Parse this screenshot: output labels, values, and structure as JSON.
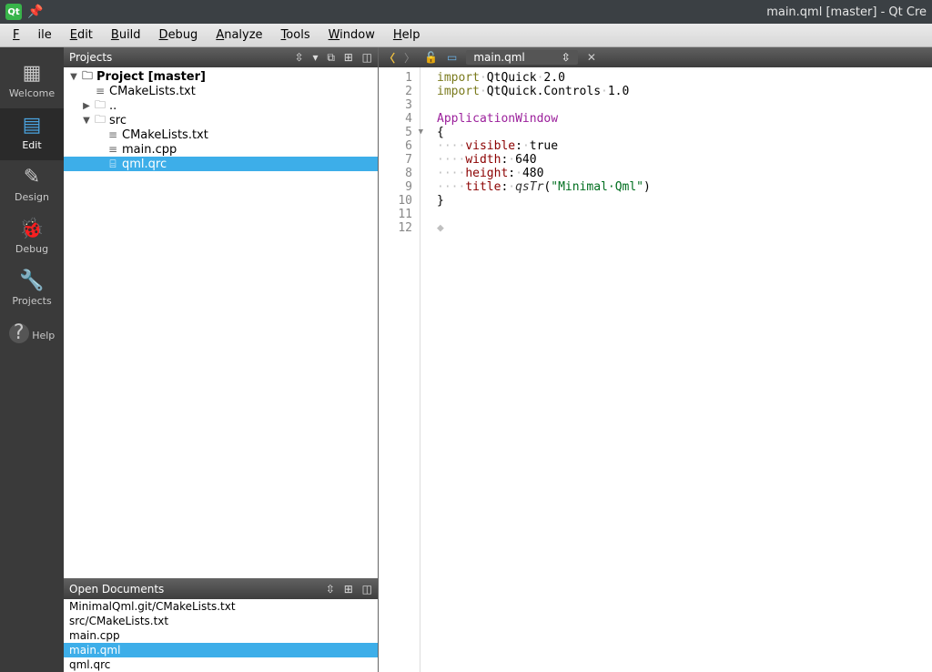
{
  "window": {
    "title": "main.qml [master] - Qt Cre"
  },
  "menu": {
    "file": "File",
    "edit": "Edit",
    "build": "Build",
    "debug": "Debug",
    "analyze": "Analyze",
    "tools": "Tools",
    "window": "Window",
    "help": "Help"
  },
  "modes": {
    "welcome": "Welcome",
    "edit": "Edit",
    "design": "Design",
    "debug": "Debug",
    "projects": "Projects",
    "help": "Help"
  },
  "projectsPanel": {
    "title": "Projects",
    "tree": {
      "root": "Project [master]",
      "cmake": "CMakeLists.txt",
      "dotdot": "..",
      "src": "src",
      "srcCmake": "CMakeLists.txt",
      "mainCpp": "main.cpp",
      "qmlQrc": "qml.qrc"
    }
  },
  "openDocsPanel": {
    "title": "Open Documents",
    "items": [
      "MinimalQml.git/CMakeLists.txt",
      "src/CMakeLists.txt",
      "main.cpp",
      "main.qml",
      "qml.qrc"
    ],
    "selectedIndex": 3
  },
  "editor": {
    "file": "main.qml",
    "lines": [
      {
        "n": "1",
        "tokens": [
          {
            "c": "kw",
            "t": "import"
          },
          {
            "c": "dots",
            "t": "·"
          },
          {
            "c": "blk",
            "t": "QtQuick"
          },
          {
            "c": "dots",
            "t": "·"
          },
          {
            "c": "num",
            "t": "2.0"
          }
        ]
      },
      {
        "n": "2",
        "tokens": [
          {
            "c": "kw",
            "t": "import"
          },
          {
            "c": "dots",
            "t": "·"
          },
          {
            "c": "blk",
            "t": "QtQuick.Controls"
          },
          {
            "c": "dots",
            "t": "·"
          },
          {
            "c": "num",
            "t": "1.0"
          }
        ]
      },
      {
        "n": "3",
        "tokens": []
      },
      {
        "n": "4",
        "tokens": [
          {
            "c": "type",
            "t": "ApplicationWindow"
          }
        ]
      },
      {
        "n": "5",
        "fold": true,
        "tokens": [
          {
            "c": "blk",
            "t": "{"
          }
        ]
      },
      {
        "n": "6",
        "tokens": [
          {
            "c": "dots",
            "t": "····"
          },
          {
            "c": "prop",
            "t": "visible"
          },
          {
            "c": "blk",
            "t": ":"
          },
          {
            "c": "dots",
            "t": "·"
          },
          {
            "c": "blk",
            "t": "true"
          }
        ]
      },
      {
        "n": "7",
        "tokens": [
          {
            "c": "dots",
            "t": "····"
          },
          {
            "c": "prop",
            "t": "width"
          },
          {
            "c": "blk",
            "t": ":"
          },
          {
            "c": "dots",
            "t": "·"
          },
          {
            "c": "num",
            "t": "640"
          }
        ]
      },
      {
        "n": "8",
        "tokens": [
          {
            "c": "dots",
            "t": "····"
          },
          {
            "c": "prop",
            "t": "height"
          },
          {
            "c": "blk",
            "t": ":"
          },
          {
            "c": "dots",
            "t": "·"
          },
          {
            "c": "num",
            "t": "480"
          }
        ]
      },
      {
        "n": "9",
        "tokens": [
          {
            "c": "dots",
            "t": "····"
          },
          {
            "c": "prop",
            "t": "title"
          },
          {
            "c": "blk",
            "t": ":"
          },
          {
            "c": "dots",
            "t": "·"
          },
          {
            "c": "fn",
            "t": "qsTr"
          },
          {
            "c": "blk",
            "t": "("
          },
          {
            "c": "str",
            "t": "\"Minimal·Qml\""
          },
          {
            "c": "blk",
            "t": ")"
          }
        ]
      },
      {
        "n": "10",
        "tokens": [
          {
            "c": "blk",
            "t": "}"
          }
        ]
      },
      {
        "n": "11",
        "tokens": []
      },
      {
        "n": "12",
        "tokens": [
          {
            "c": "dots",
            "t": "◆"
          }
        ]
      }
    ]
  }
}
